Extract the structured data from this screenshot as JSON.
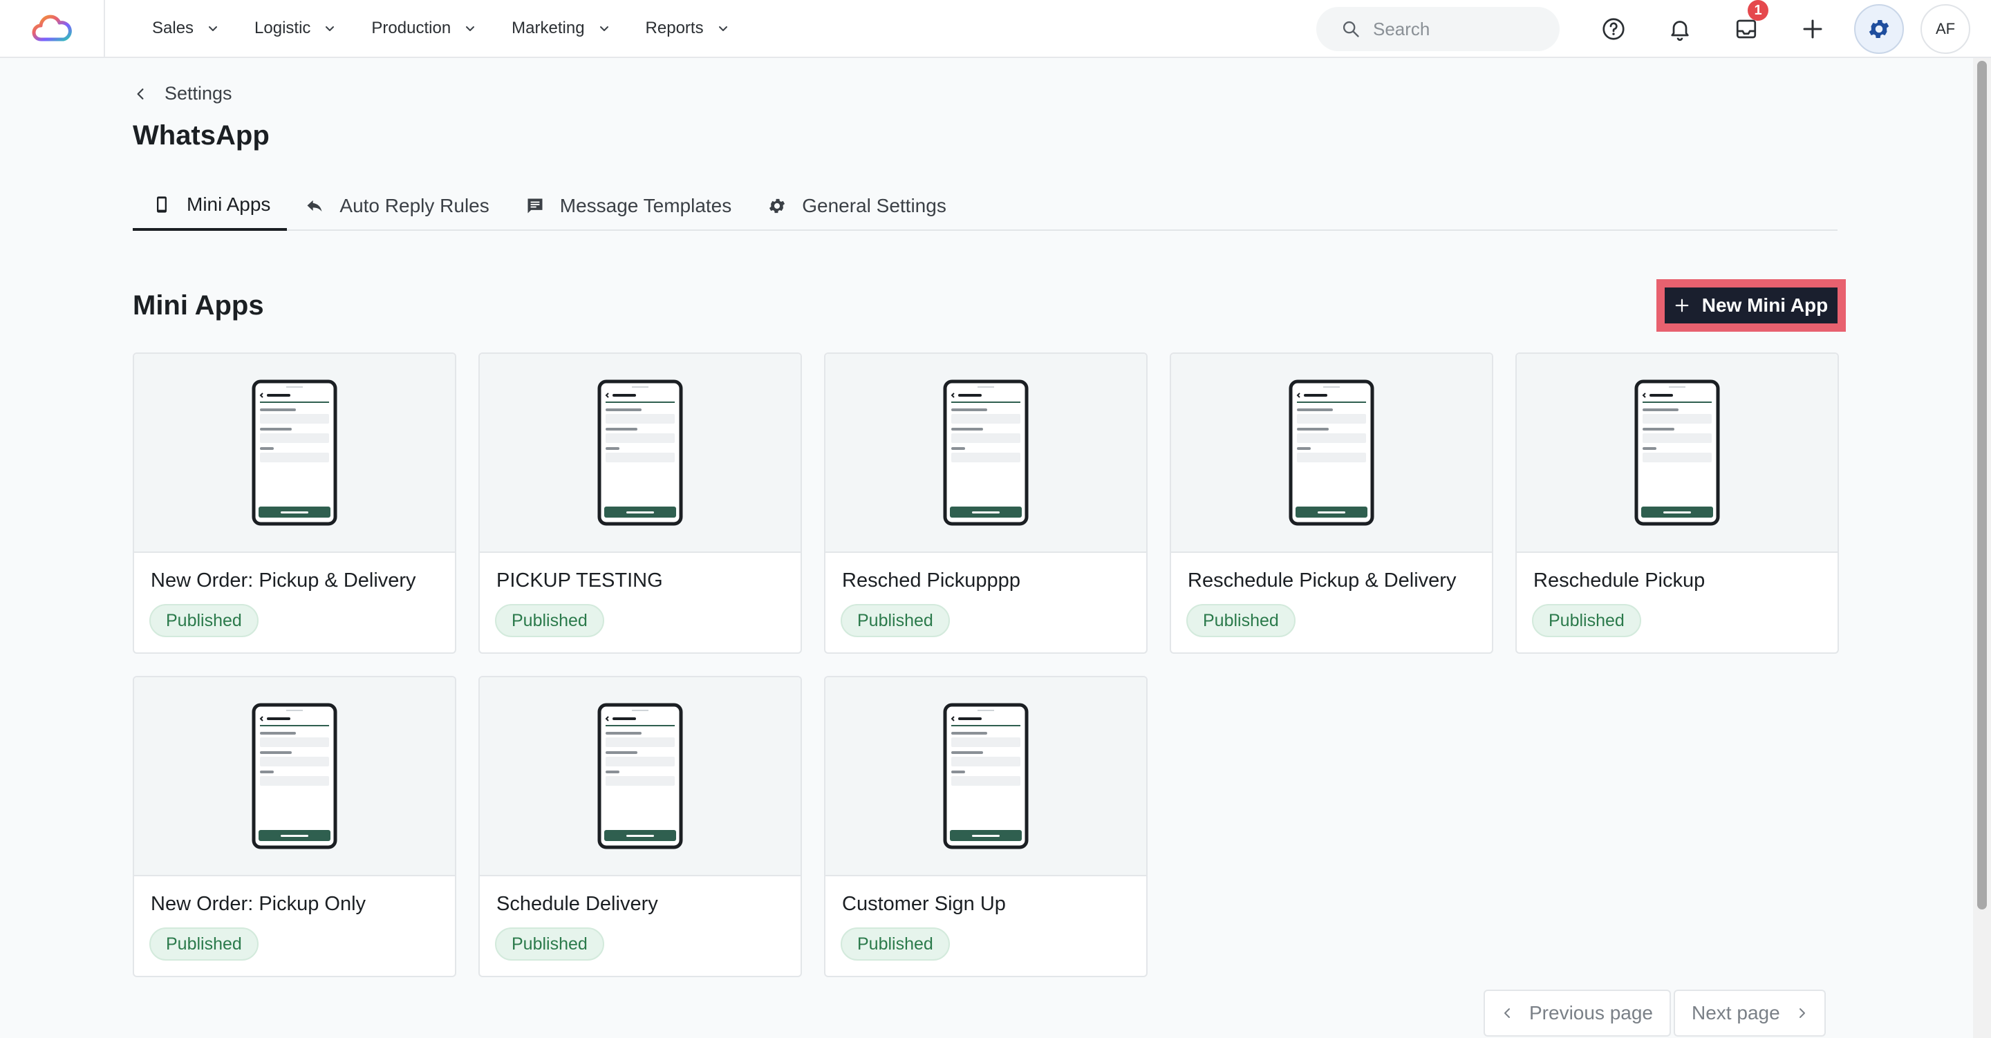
{
  "nav": {
    "items": [
      {
        "label": "Sales"
      },
      {
        "label": "Logistic"
      },
      {
        "label": "Production"
      },
      {
        "label": "Marketing"
      },
      {
        "label": "Reports"
      }
    ]
  },
  "header": {
    "search_placeholder": "Search",
    "inbox_badge": "1",
    "avatar_initials": "AF"
  },
  "breadcrumb": {
    "back_label": "Settings"
  },
  "page": {
    "title": "WhatsApp"
  },
  "tabs": [
    {
      "label": "Mini Apps",
      "icon": "phone-icon",
      "active": true
    },
    {
      "label": "Auto Reply Rules",
      "icon": "reply-icon",
      "active": false
    },
    {
      "label": "Message Templates",
      "icon": "message-icon",
      "active": false
    },
    {
      "label": "General Settings",
      "icon": "gear-icon",
      "active": false
    }
  ],
  "section": {
    "title": "Mini Apps",
    "new_button_label": "New Mini App"
  },
  "mini_apps": [
    {
      "name": "New Order: Pickup & Delivery",
      "status": "Published"
    },
    {
      "name": "PICKUP TESTING",
      "status": "Published"
    },
    {
      "name": "Resched Pickupppp",
      "status": "Published"
    },
    {
      "name": "Reschedule Pickup & Delivery",
      "status": "Published"
    },
    {
      "name": "Reschedule Pickup",
      "status": "Published"
    },
    {
      "name": "New Order: Pickup Only",
      "status": "Published"
    },
    {
      "name": "Schedule Delivery",
      "status": "Published"
    },
    {
      "name": "Customer Sign Up",
      "status": "Published"
    }
  ],
  "pagination": {
    "previous_label": "Previous page",
    "next_label": "Next page"
  },
  "colors": {
    "accent_dark": "#1a1f2e",
    "highlight": "#e8616f",
    "published_bg": "#e6f4ec",
    "published_text": "#2b7a4b",
    "phone_button": "#2f5f4f"
  }
}
